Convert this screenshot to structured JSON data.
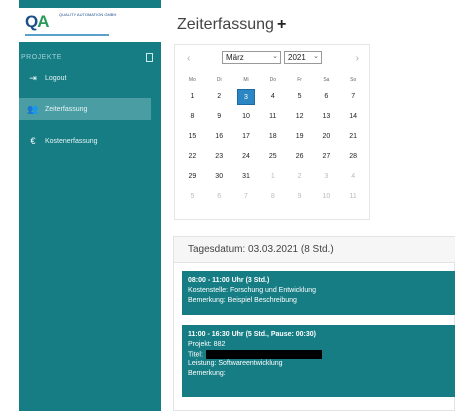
{
  "logo": {
    "mark": "QA",
    "tagline": "Quality Automation GmbH"
  },
  "sidebar": {
    "section_label": "PROJEKTE",
    "items": [
      {
        "label": "Logout",
        "icon": "logout-icon"
      },
      {
        "label": "Zeiterfassung",
        "icon": "users-icon",
        "active": true
      },
      {
        "label": "Kostenerfassung",
        "icon": "euro-icon"
      }
    ]
  },
  "header": {
    "title": "Zeiterfassung",
    "add_symbol": "+"
  },
  "calendar": {
    "prev": "‹",
    "next": "›",
    "month": "März",
    "year": "2021",
    "weekdays": [
      "Mo",
      "Di",
      "Mi",
      "Do",
      "Fr",
      "Sa",
      "So"
    ],
    "weeks": [
      [
        "1",
        "2",
        "3",
        "4",
        "5",
        "6",
        "7"
      ],
      [
        "8",
        "9",
        "10",
        "11",
        "12",
        "13",
        "14"
      ],
      [
        "15",
        "16",
        "17",
        "18",
        "19",
        "20",
        "21"
      ],
      [
        "22",
        "23",
        "24",
        "25",
        "26",
        "27",
        "28"
      ],
      [
        "29",
        "30",
        "31",
        "1",
        "2",
        "3",
        "4"
      ],
      [
        "5",
        "6",
        "7",
        "8",
        "9",
        "10",
        "11"
      ]
    ],
    "selected_day": "3"
  },
  "day": {
    "header": "Tagesdatum: 03.03.2021 (8 Std.)",
    "entries": [
      {
        "time": "08:00 - 11:00 Uhr (3 Std.)",
        "lines": [
          "Kostenstelle: Forschung und Entwicklung",
          "Bemerkung: Beispiel Beschreibung"
        ]
      },
      {
        "time": "11:00 - 16:30 Uhr (5 Std., Pause: 00:30)",
        "project": "Projekt: 882",
        "titel": "Titel:",
        "leistung": "Leistung: Softwareentwicklung",
        "bemerkung": "Bemerkung:"
      }
    ]
  }
}
